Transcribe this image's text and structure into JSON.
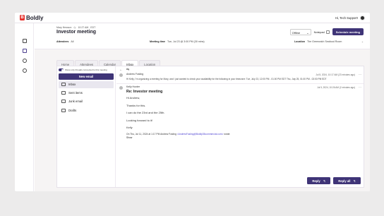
{
  "app": {
    "brand": "Boldly",
    "user_greeting": "Hi, Tech Support!"
  },
  "header": {
    "meta": [
      "Mary Hewson",
      "10:27 AM",
      "EDT"
    ],
    "title": "Investor meeting",
    "status": "Offline",
    "notepad_label": "Notepad",
    "schedule_label": "Schedule meeting",
    "attendees_label": "Attendees",
    "attendees_value": "All",
    "meeting_time_label": "Meeting time",
    "meeting_time_value": "Tue, Jul 23 @ 3:00 PM (30 mins)",
    "location_label": "Location",
    "location_value": "The Greenwich Seafood Room"
  },
  "tabs": [
    {
      "label": "Home",
      "active": false
    },
    {
      "label": "Attendees",
      "active": false
    },
    {
      "label": "Calendar",
      "active": false
    },
    {
      "label": "Inbox",
      "active": true
    },
    {
      "label": "Location",
      "active": false
    }
  ],
  "inbox": {
    "toggle_label": "Show only threads connected to this meeting",
    "new_email_label": "New email",
    "folders": [
      {
        "label": "Inbox",
        "icon": "inbox-icon",
        "active": true
      },
      {
        "label": "Sent items",
        "icon": "sent-icon",
        "active": false
      },
      {
        "label": "Junk email",
        "icon": "junk-icon",
        "active": false
      },
      {
        "label": "Drafts",
        "icon": "drafts-icon",
        "active": false
      }
    ]
  },
  "messages": [
    {
      "sender": "Andrew Fosling",
      "timestamp": "Jul 5, 2024, 10:17 AM (23 minutes ago)",
      "preview": "Hi Kelly, I'm organizing a meeting for Mary, and I just wanted to check your availability for the following in your timezone: Tue, July 23, 12:00 PM - 01:00 PM EDT Thu, July 25, 01:00 PM - 02:00 PM EDT"
    },
    {
      "sender": "Kelly Hunter",
      "timestamp": "Jul 5, 2024, 10:26 AM (2 minutes ago)",
      "subject": "Re: Investor meeting",
      "body": [
        "Hi Andrew,",
        "Thanks for this.",
        "I can do the 23rd and the 25th.",
        "Looking forward to it!",
        "Kelly"
      ],
      "quote_prefix": "On Thu, Jul 11, 2024 at 1:17 PM Andrew Fosling",
      "quote_link": "<AndrewFosling@Boldly35commercial.com>",
      "quote_suffix": "wrote:",
      "show_label": "Show"
    }
  ],
  "actions": {
    "reply_label": "Reply",
    "reply_all_label": "Reply all"
  },
  "colors": {
    "accent": "#3f3477",
    "brand_red": "#e5322d",
    "link": "#4a3fd1"
  }
}
